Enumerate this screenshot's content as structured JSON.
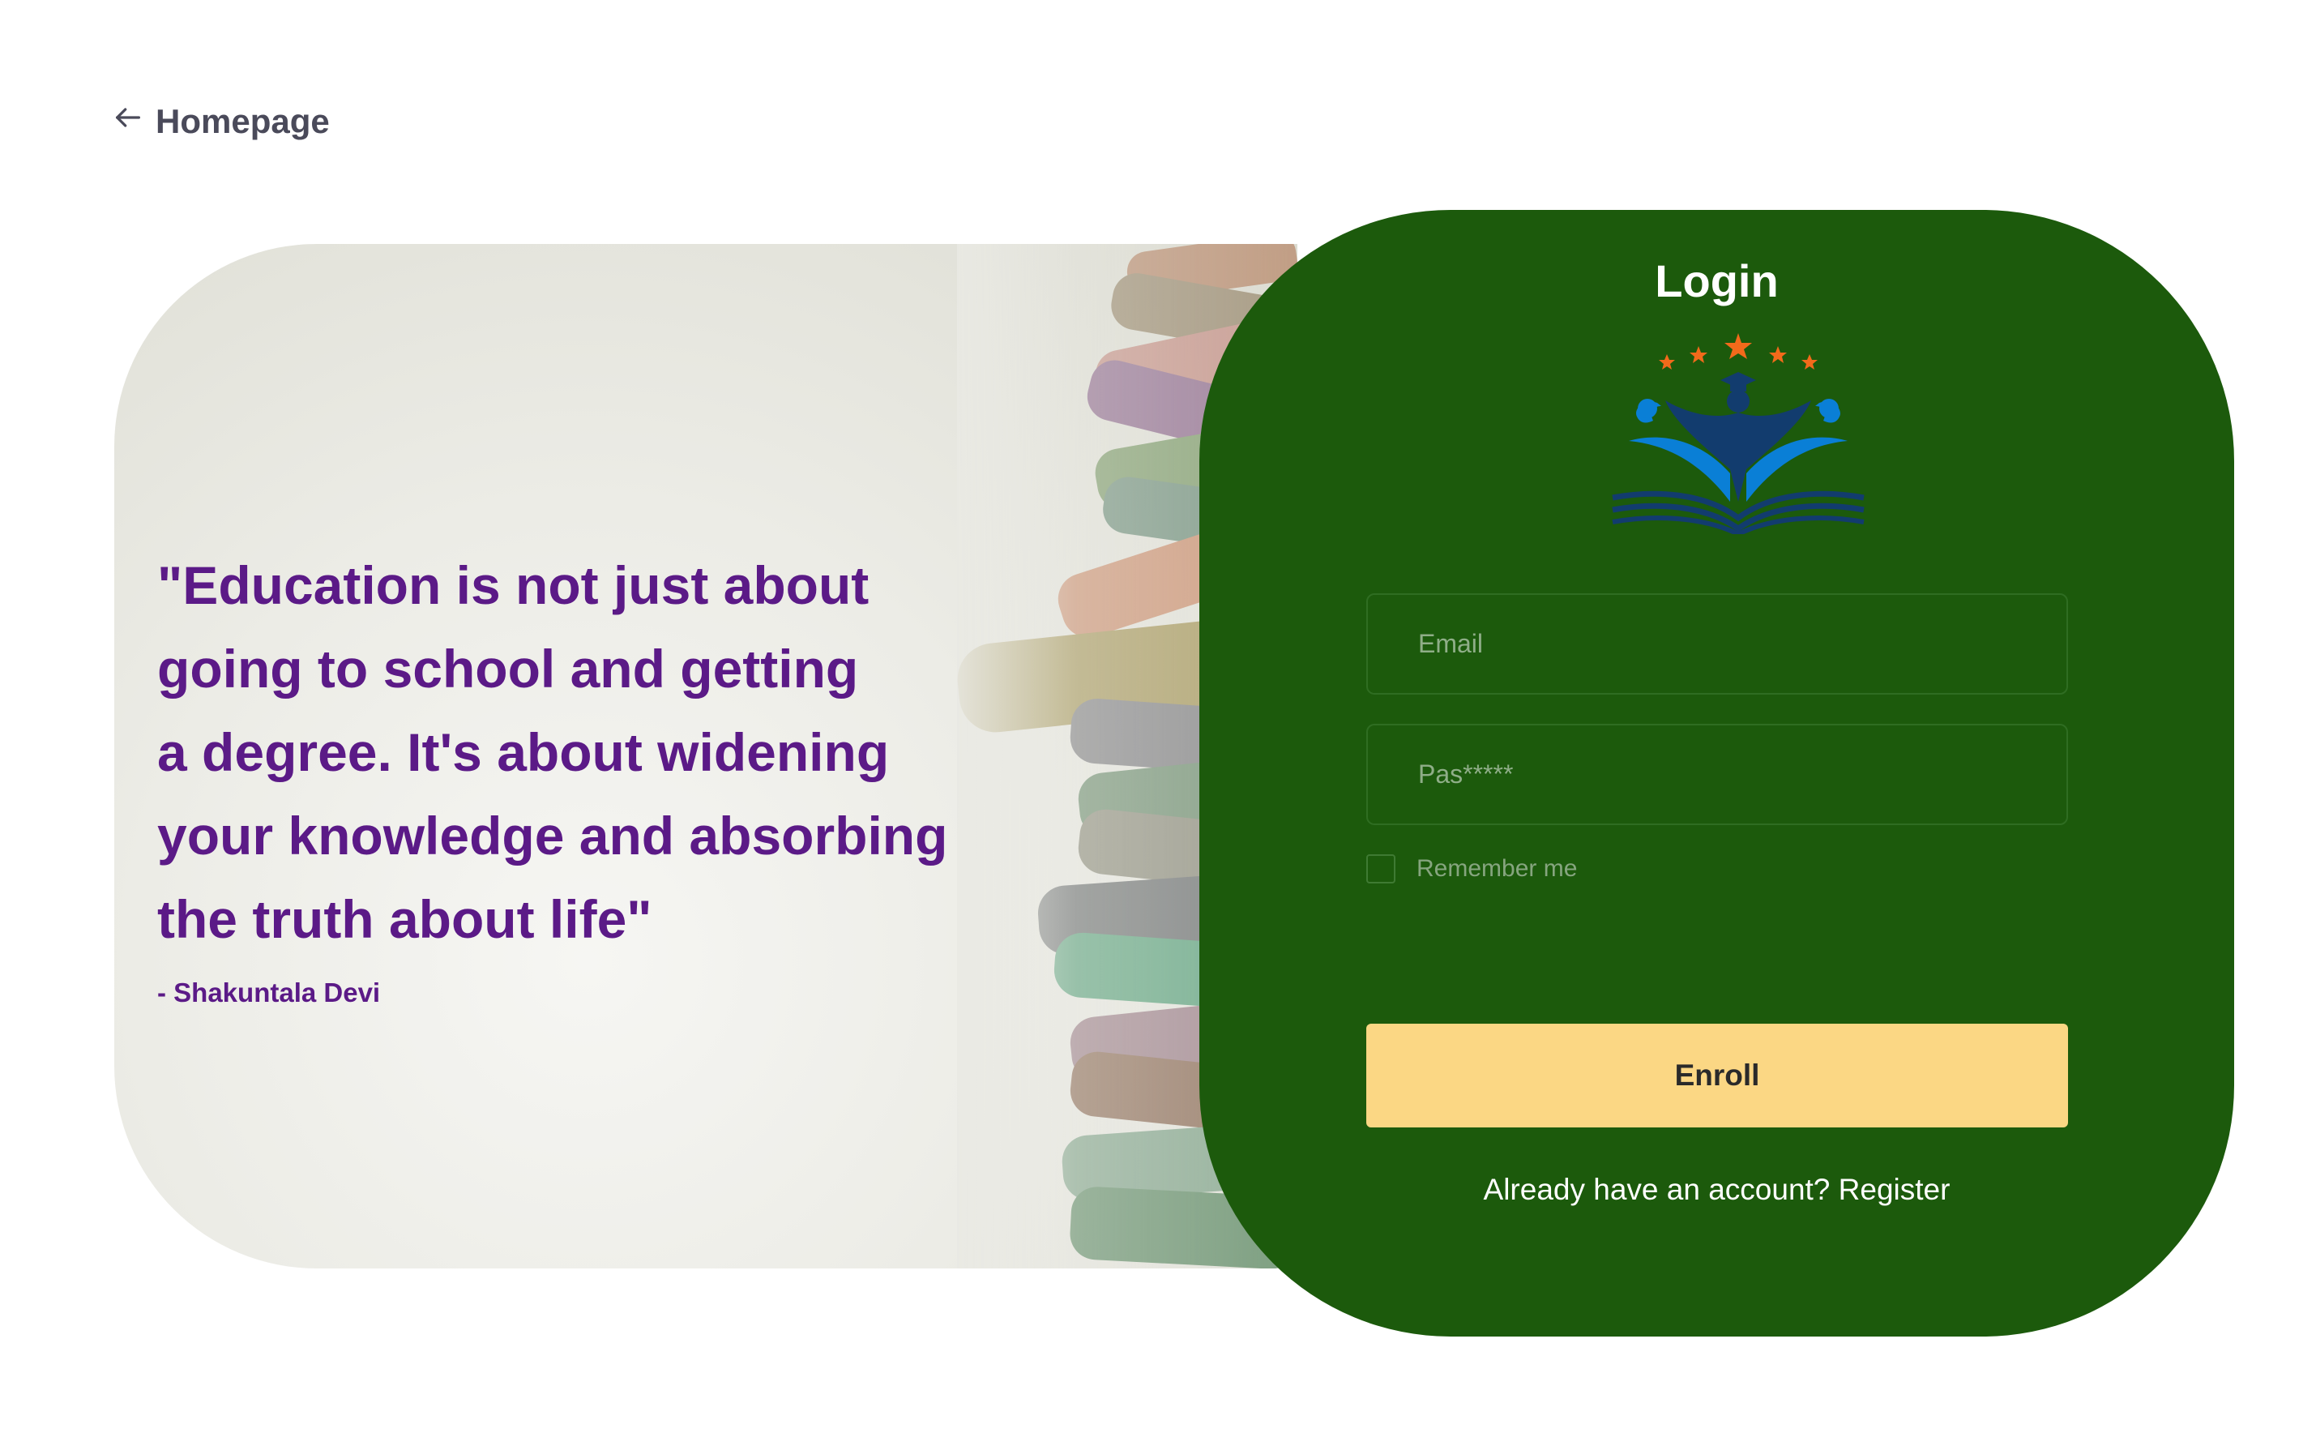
{
  "nav": {
    "back_label": "Homepage"
  },
  "hero": {
    "quote_lines": [
      "\"Education is not just about",
      "going to school and getting",
      "a degree. It's about widening",
      "your knowledge and absorbing",
      "the truth about life\""
    ],
    "author": "- Shakuntala Devi"
  },
  "login": {
    "title": "Login",
    "email_placeholder": "Email",
    "password_placeholder": "Pas*****",
    "remember_label": "Remember me",
    "submit_label": "Enroll",
    "register_prefix": "Already have an account?",
    "register_link": "Register"
  },
  "colors": {
    "card_green": "#1c5a0c",
    "quote_purple": "#5b1a87",
    "button_yellow": "#fbd784",
    "logo_blue": "#0a7fd6",
    "logo_navy": "#123c6e",
    "logo_star": "#f26a1b"
  },
  "icons": {
    "back": "arrow-left-icon",
    "logo": "education-book-logo"
  }
}
